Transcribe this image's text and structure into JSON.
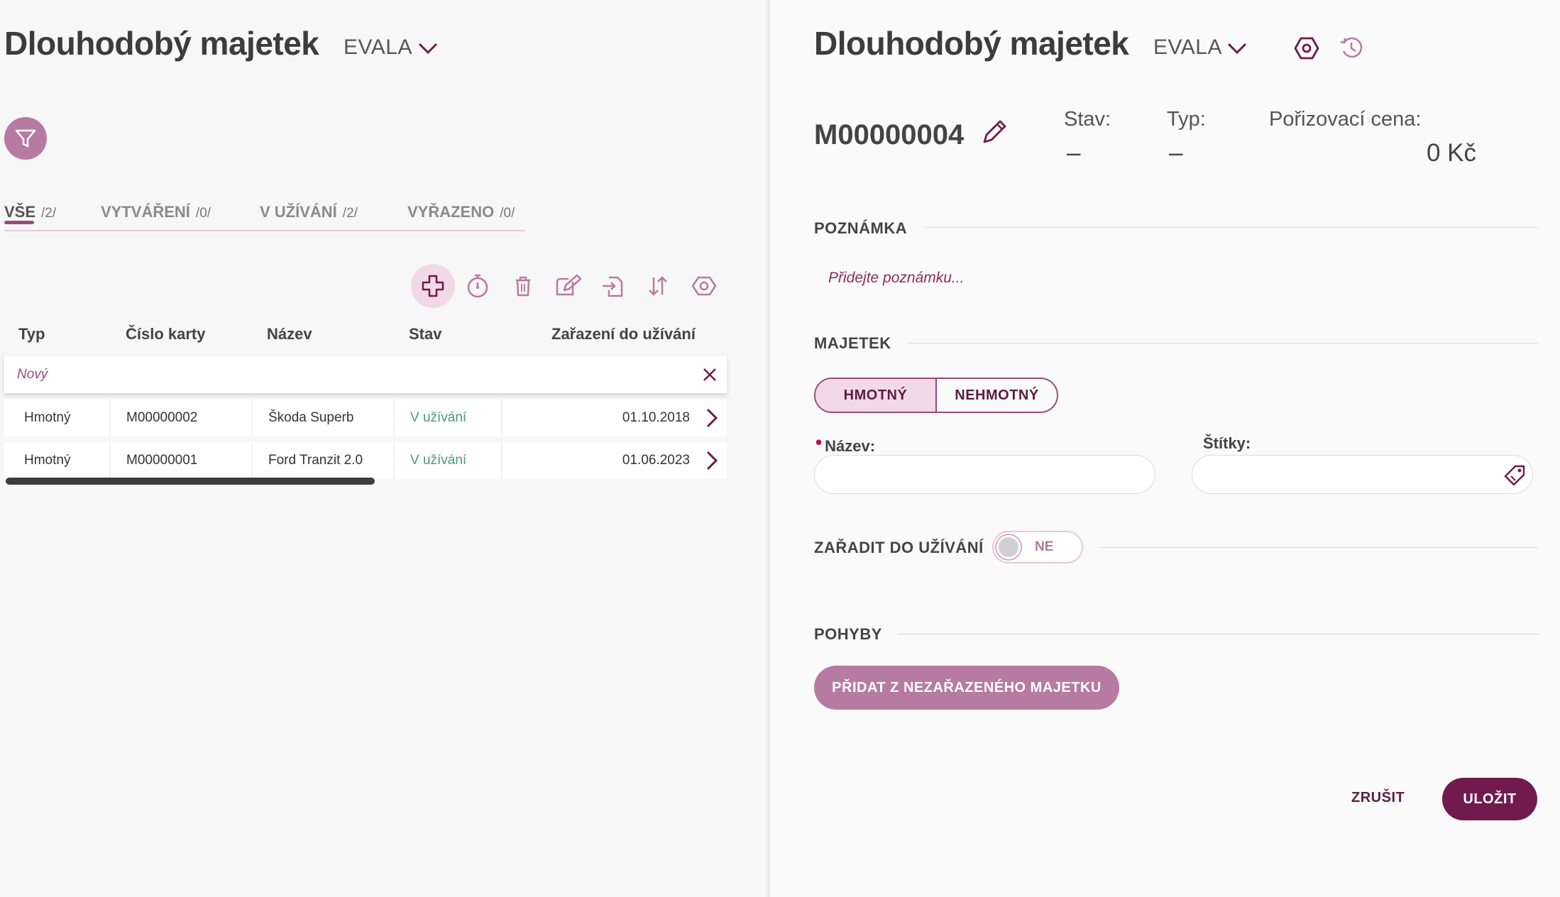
{
  "left": {
    "title": "Dlouhodobý majetek",
    "company": "EVALA",
    "tabs": [
      {
        "label": "VŠE",
        "count": "/2/"
      },
      {
        "label": "VYTVÁŘENÍ",
        "count": "/0/"
      },
      {
        "label": "V UŽÍVÁNÍ",
        "count": "/2/"
      },
      {
        "label": "VYŘAZENO",
        "count": "/0/"
      }
    ],
    "active_tab": "VŠE",
    "table": {
      "columns": [
        "Typ",
        "Číslo karty",
        "Název",
        "Stav",
        "Zařazení do užívání"
      ],
      "new_row_label": "Nový",
      "rows": [
        {
          "typ": "Hmotný",
          "cislo": "M00000002",
          "nazev": "Škoda Superb",
          "stav": "V užívání",
          "zarazeni": "01.10.2018"
        },
        {
          "typ": "Hmotný",
          "cislo": "M00000001",
          "nazev": "Ford Tranzit 2.0",
          "stav": "V užívání",
          "zarazeni": "01.06.2023"
        }
      ]
    }
  },
  "right": {
    "title": "Dlouhodobý majetek",
    "company": "EVALA",
    "asset_id": "M00000004",
    "stav_label": "Stav:",
    "stav_value": "–",
    "typ_label": "Typ:",
    "typ_value": "–",
    "cena_label": "Pořizovací cena:",
    "cena_value": "0 Kč",
    "poznamka_title": "POZNÁMKA",
    "poznamka_placeholder": "Přidejte poznámku...",
    "majetek_title": "MAJETEK",
    "segment": [
      "HMOTNÝ",
      "NEHMOTNÝ"
    ],
    "segment_selected": "HMOTNÝ",
    "nazev_label": "Název:",
    "stitky_label": "Štítky:",
    "zaradit_title": "ZAŘADIT DO UŽÍVÁNÍ",
    "zaradit_value": "NE",
    "pohyby_title": "POHYBY",
    "add_button": "PŘIDAT Z NEZAŘAZENÉHO MAJETKU",
    "cancel_button": "ZRUŠIT",
    "save_button": "ULOŽIT"
  },
  "colors": {
    "accent": "#9a4a7c",
    "accent_dark": "#701a4e",
    "accent_light": "#f2d9e7",
    "filter_bg": "#b77aa3",
    "status_green": "#4a9a73"
  }
}
